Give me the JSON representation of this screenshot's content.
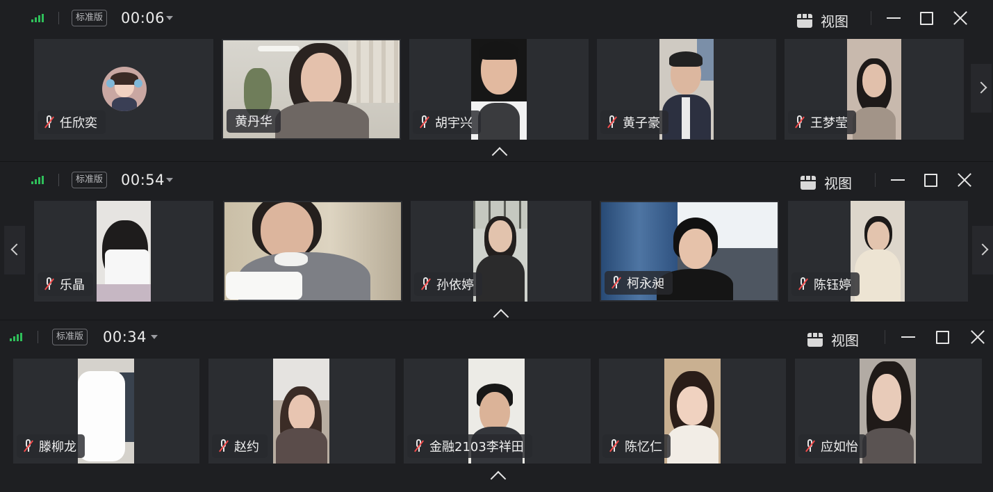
{
  "windows": [
    {
      "badge": "标准版",
      "timer": "00:06",
      "view_label": "视图",
      "participants": [
        {
          "name": "任欣奕",
          "muted": true
        },
        {
          "name": "黄丹华",
          "muted": false
        },
        {
          "name": "胡宇兴",
          "muted": true
        },
        {
          "name": "黄子豪",
          "muted": true
        },
        {
          "name": "王梦莹",
          "muted": true
        }
      ]
    },
    {
      "badge": "标准版",
      "timer": "00:54",
      "view_label": "视图",
      "participants": [
        {
          "name": "乐晶",
          "muted": true
        },
        {
          "name": "",
          "muted": false
        },
        {
          "name": "孙依婷",
          "muted": true
        },
        {
          "name": "柯永昶",
          "muted": true
        },
        {
          "name": "陈钰婷",
          "muted": true
        }
      ]
    },
    {
      "badge": "标准版",
      "timer": "00:34",
      "view_label": "视图",
      "participants": [
        {
          "name": "滕柳龙",
          "muted": true
        },
        {
          "name": "赵约",
          "muted": true
        },
        {
          "name": "金融2103李祥田",
          "muted": true
        },
        {
          "name": "陈忆仁",
          "muted": true
        },
        {
          "name": "应如怡",
          "muted": true
        }
      ]
    }
  ],
  "colors": {
    "signal": "#2fbf5a",
    "mute_slash": "#f24b4b",
    "background": "#1e1f22",
    "tile": "#2b2d31"
  }
}
